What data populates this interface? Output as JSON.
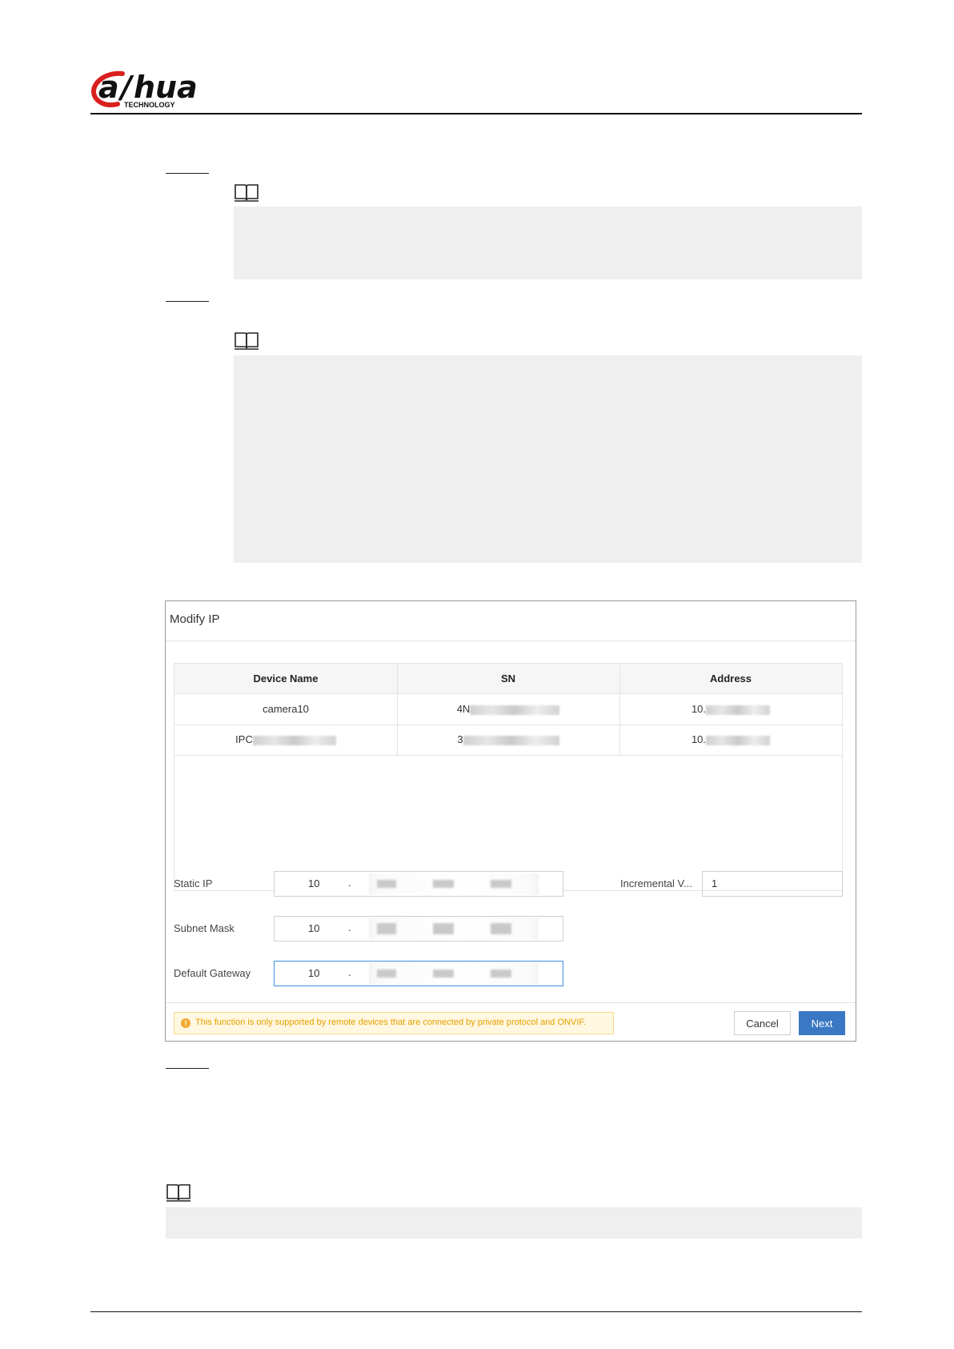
{
  "header": {
    "logo_text": "alhua",
    "logo_sub": "TECHNOLOGY"
  },
  "dialog": {
    "title": "Modify IP",
    "table": {
      "headers": [
        "Device Name",
        "SN",
        "Address"
      ],
      "rows": [
        {
          "device_name": "camera10",
          "sn": "4N",
          "address": "10."
        },
        {
          "device_name": "IPC",
          "sn": "3",
          "address": "10."
        }
      ]
    },
    "form": {
      "static_ip_label": "Static IP",
      "static_ip_first": "10",
      "subnet_mask_label": "Subnet Mask",
      "subnet_mask_first": "10",
      "default_gateway_label": "Default Gateway",
      "default_gateway_first": "10",
      "ip_separator": ".",
      "incremental_label": "Incremental V...",
      "incremental_value": "1"
    },
    "warning": "This function is only supported by remote devices that are connected by private protocol and ONVIF.",
    "cancel_label": "Cancel",
    "next_label": "Next",
    "colors": {
      "primary": "#3a78c3",
      "warning_text": "#e6a000",
      "warning_bg": "#fff7e0",
      "logo_red": "#d9201f"
    }
  }
}
